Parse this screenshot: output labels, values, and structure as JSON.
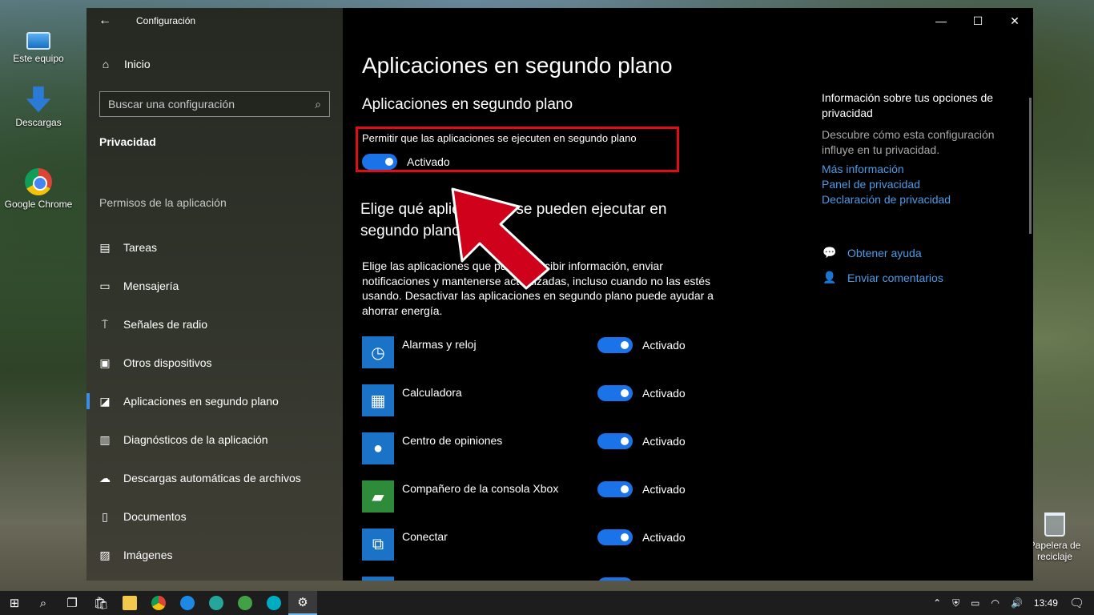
{
  "desktop": {
    "icons": [
      {
        "label": "Este equipo",
        "icon": "computer-icon"
      },
      {
        "label": "Descargas",
        "icon": "downloads-icon"
      },
      {
        "label": "Google Chrome",
        "icon": "chrome-icon"
      },
      {
        "label": "Papelera de reciclaje",
        "icon": "recycle-bin-icon"
      }
    ]
  },
  "window": {
    "app_title": "Configuración",
    "controls": {
      "minimize": "—",
      "maximize": "☐",
      "close": "✕"
    }
  },
  "sidebar": {
    "home": "Inicio",
    "search_placeholder": "Buscar una configuración",
    "section": "Privacidad",
    "group_label": "Permisos de la aplicación",
    "items": [
      {
        "label": "Tareas",
        "icon": "tasks-icon",
        "glyph": "▤"
      },
      {
        "label": "Mensajería",
        "icon": "messaging-icon",
        "glyph": "▭"
      },
      {
        "label": "Señales de radio",
        "icon": "radio-icon",
        "glyph": "⍑"
      },
      {
        "label": "Otros dispositivos",
        "icon": "devices-icon",
        "glyph": "▣"
      },
      {
        "label": "Aplicaciones en segundo plano",
        "icon": "background-apps-icon",
        "glyph": "◪",
        "active": true
      },
      {
        "label": "Diagnósticos de la aplicación",
        "icon": "diagnostics-icon",
        "glyph": "▥"
      },
      {
        "label": "Descargas automáticas de archivos",
        "icon": "cloud-icon",
        "glyph": "☁"
      },
      {
        "label": "Documentos",
        "icon": "document-icon",
        "glyph": "▯"
      },
      {
        "label": "Imágenes",
        "icon": "image-icon",
        "glyph": "▨"
      }
    ]
  },
  "main": {
    "page_title": "Aplicaciones en segundo plano",
    "section_title": "Aplicaciones en segundo plano",
    "permit_label": "Permitir que las aplicaciones se ejecuten en segundo plano",
    "permit_state": "Activado",
    "choose_title": "Elige qué aplicaciones se pueden ejecutar en segundo plano",
    "choose_desc": "Elige las aplicaciones que pueden recibir información, enviar notificaciones y mantenerse actualizadas, incluso cuando no las estés usando. Desactivar las aplicaciones en segundo plano puede ayudar a ahorrar energía.",
    "apps": [
      {
        "name": "Alarmas y reloj",
        "state": "Activado",
        "icon": "alarm-clock-icon",
        "glyph": "◷",
        "color": "#1a73c6"
      },
      {
        "name": "Calculadora",
        "state": "Activado",
        "icon": "calculator-icon",
        "glyph": "▦",
        "color": "#1a73c6"
      },
      {
        "name": "Centro de opiniones",
        "state": "Activado",
        "icon": "feedback-hub-icon",
        "glyph": "●",
        "color": "#1a73c6"
      },
      {
        "name": "Compañero de la consola Xbox",
        "state": "Activado",
        "icon": "xbox-icon",
        "glyph": "▰",
        "color": "#2e8b3a"
      },
      {
        "name": "Conectar",
        "state": "Activado",
        "icon": "connect-icon",
        "glyph": "⧉",
        "color": "#1a73c6"
      }
    ]
  },
  "right_panel": {
    "title": "Información sobre tus opciones de privacidad",
    "desc": "Descubre cómo esta configuración influye en tu privacidad.",
    "links": [
      "Más información",
      "Panel de privacidad",
      "Declaración de privacidad"
    ],
    "help": "Obtener ayuda",
    "feedback": "Enviar comentarios"
  },
  "taskbar": {
    "time": "13:49",
    "accent": "#76b9ed"
  },
  "colors": {
    "toggle_on": "#1a73e8",
    "link": "#4c9ce8",
    "highlight_box": "#e30b17",
    "arrow": "#d0021b"
  }
}
